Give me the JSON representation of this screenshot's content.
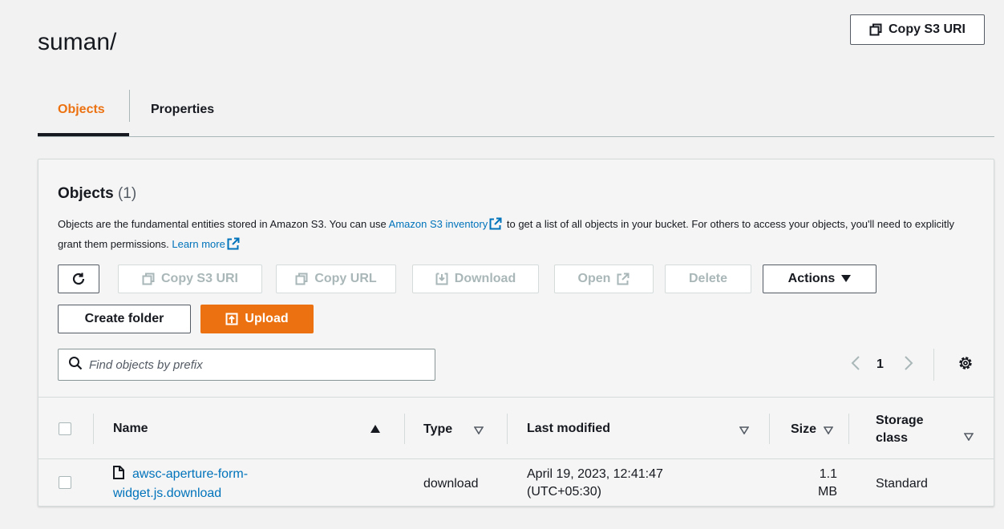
{
  "header": {
    "title": "suman/",
    "copy_s3_uri": "Copy S3 URI"
  },
  "tabs": [
    {
      "label": "Objects",
      "active": true
    },
    {
      "label": "Properties",
      "active": false
    }
  ],
  "objects_panel": {
    "title": "Objects",
    "count": "(1)",
    "desc_part1": "Objects are the fundamental entities stored in Amazon S3. You can use",
    "desc_link1": "Amazon S3 inventory",
    "desc_part2": "to get a list of all objects in your bucket. For others to access your objects, you'll need to explicitly grant them permissions.",
    "desc_link2": "Learn more"
  },
  "toolbar": {
    "copy_s3_uri": "Copy S3 URI",
    "copy_url": "Copy URL",
    "download": "Download",
    "open": "Open",
    "delete": "Delete",
    "actions": "Actions",
    "create_folder": "Create folder",
    "upload": "Upload"
  },
  "search": {
    "placeholder": "Find objects by prefix"
  },
  "pagination": {
    "current_page": "1"
  },
  "table": {
    "columns": {
      "name": "Name",
      "type": "Type",
      "last_modified": "Last modified",
      "size": "Size",
      "storage_class_line1": "Storage",
      "storage_class_line2": "class"
    },
    "rows": [
      {
        "name_line1": "awsc-aperture-form-",
        "name_line2": "widget.js.download",
        "type": "download",
        "last_modified_line1": "April 19, 2023, 12:41:47",
        "last_modified_line2": "(UTC+05:30)",
        "size_line1": "1.1",
        "size_line2": "MB",
        "storage_class": "Standard"
      }
    ]
  },
  "colors": {
    "accent": "#ec7211",
    "link": "#0073bb",
    "text": "#16191f",
    "disabled": "#aab7b8"
  }
}
